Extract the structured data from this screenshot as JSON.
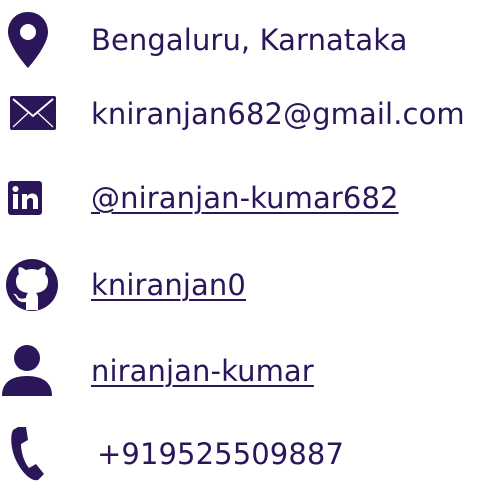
{
  "colors": {
    "icon": "#2a1658",
    "text": "#2a1658",
    "background": "#ffffff"
  },
  "contacts": [
    {
      "icon": "map-pin-icon",
      "text": "Bengaluru, Karnataka",
      "link": false
    },
    {
      "icon": "envelope-icon",
      "text": "kniranjan682@gmail.com",
      "link": false
    },
    {
      "icon": "linkedin-icon",
      "text": "@niranjan-kumar682",
      "link": true
    },
    {
      "icon": "github-icon",
      "text": "kniranjan0",
      "link": true
    },
    {
      "icon": "user-icon",
      "text": "niranjan-kumar",
      "link": true
    },
    {
      "icon": "phone-icon",
      "text": "+919525509887",
      "link": false
    }
  ]
}
